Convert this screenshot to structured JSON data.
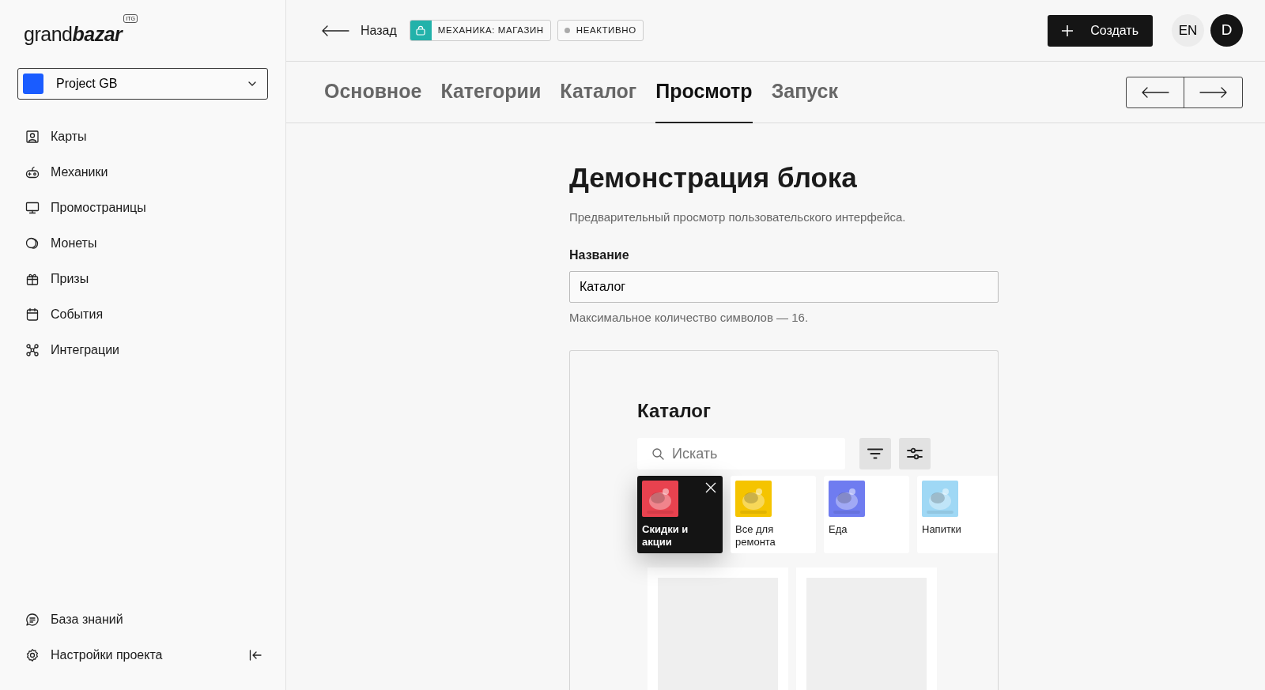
{
  "logo": {
    "text": "grand**bazar**",
    "badge": "ITG"
  },
  "project": {
    "name": "Project GB"
  },
  "nav": [
    {
      "label": "Карты"
    },
    {
      "label": "Механики"
    },
    {
      "label": "Промостраницы"
    },
    {
      "label": "Монеты"
    },
    {
      "label": "Призы"
    },
    {
      "label": "События"
    },
    {
      "label": "Интеграции"
    }
  ],
  "nav_bottom": [
    {
      "label": "База знаний"
    },
    {
      "label": "Настройки проекта"
    }
  ],
  "header": {
    "back": "Назад",
    "mechanic_tag": "МЕХАНИКА: МАГАЗИН",
    "status": "НЕАКТИВНО",
    "create": "Создать",
    "language": "EN",
    "avatar": "D"
  },
  "tabs": [
    {
      "label": "Основное",
      "selected": false
    },
    {
      "label": "Категории",
      "selected": false
    },
    {
      "label": "Каталог",
      "selected": false
    },
    {
      "label": "Просмотр",
      "selected": true
    },
    {
      "label": "Запуск",
      "selected": false
    }
  ],
  "content": {
    "title": "Демонстрация блока",
    "subtitle": "Предварительный просмотр пользовательского интерфейса.",
    "field_label": "Название",
    "field_value": "Каталог",
    "hint": "Максимальное количество символов — 16."
  },
  "preview": {
    "title": "Каталог",
    "search_placeholder": "Искать",
    "categories": [
      {
        "label": "Скидки и акции",
        "selected": true,
        "color": "#e8424f"
      },
      {
        "label": "Все для ремонта",
        "selected": false,
        "color": "#f5c400"
      },
      {
        "label": "Еда",
        "selected": false,
        "color": "#6f7cf0"
      },
      {
        "label": "Напитки",
        "selected": false,
        "color": "#9fd8f5"
      }
    ],
    "products": [
      {
        "kind": "placeholder"
      },
      {
        "kind": "placeholder"
      }
    ]
  }
}
